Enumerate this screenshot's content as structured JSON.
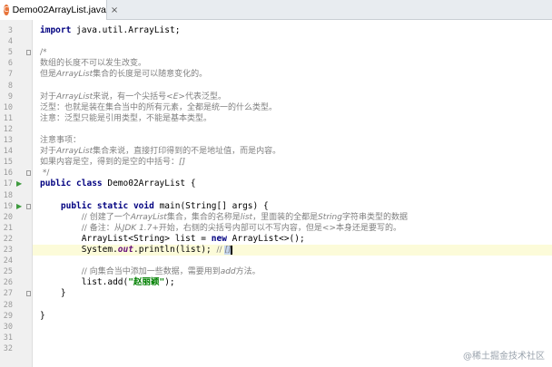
{
  "tab": {
    "icon": "java-class-icon",
    "title": "Demo02ArrayList.java",
    "close": "×"
  },
  "lines": [
    {
      "n": "3",
      "parts": [
        {
          "t": "import ",
          "c": "kw"
        },
        {
          "t": "java.util.ArrayList;",
          "c": ""
        }
      ]
    },
    {
      "n": "4",
      "parts": []
    },
    {
      "n": "5",
      "parts": [
        {
          "t": "/*",
          "c": "cm"
        }
      ]
    },
    {
      "n": "6",
      "parts": [
        {
          "t": "数组的长度不可以发生改变。",
          "c": "cm"
        }
      ]
    },
    {
      "n": "7",
      "parts": [
        {
          "t": "但是",
          "c": "cm"
        },
        {
          "t": "ArrayList",
          "c": "cm cmi"
        },
        {
          "t": "集合的长度是可以随意变化的。",
          "c": "cm"
        }
      ]
    },
    {
      "n": "8",
      "parts": []
    },
    {
      "n": "9",
      "parts": [
        {
          "t": "对于",
          "c": "cm"
        },
        {
          "t": "ArrayList",
          "c": "cm cmi"
        },
        {
          "t": "来说，有一个尖括号",
          "c": "cm"
        },
        {
          "t": "<E>",
          "c": "cm cmi"
        },
        {
          "t": "代表泛型。",
          "c": "cm"
        }
      ]
    },
    {
      "n": "10",
      "parts": [
        {
          "t": "泛型：也就是装在集合当中的所有元素，全都是统一的什么类型。",
          "c": "cm"
        }
      ]
    },
    {
      "n": "11",
      "parts": [
        {
          "t": "注意：泛型只能是引用类型，不能是基本类型。",
          "c": "cm"
        }
      ]
    },
    {
      "n": "12",
      "parts": []
    },
    {
      "n": "13",
      "parts": [
        {
          "t": "注意事项：",
          "c": "cm"
        }
      ]
    },
    {
      "n": "14",
      "parts": [
        {
          "t": "对于",
          "c": "cm"
        },
        {
          "t": "ArrayList",
          "c": "cm cmi"
        },
        {
          "t": "集合来说，直接打印得到的不是地址值，而是内容。",
          "c": "cm"
        }
      ]
    },
    {
      "n": "15",
      "parts": [
        {
          "t": "如果内容是空，得到的是空的中括号：",
          "c": "cm"
        },
        {
          "t": "[]",
          "c": "cm cmi"
        }
      ]
    },
    {
      "n": "16",
      "parts": [
        {
          "t": " */",
          "c": "cm"
        }
      ]
    },
    {
      "n": "17",
      "parts": [
        {
          "t": "public class ",
          "c": "kw"
        },
        {
          "t": "Demo02ArrayList {",
          "c": ""
        }
      ]
    },
    {
      "n": "18",
      "parts": []
    },
    {
      "n": "19",
      "parts": [
        {
          "t": "    ",
          "c": ""
        },
        {
          "t": "public static void ",
          "c": "kw"
        },
        {
          "t": "main(String[] args) {",
          "c": ""
        }
      ]
    },
    {
      "n": "20",
      "parts": [
        {
          "t": "        ",
          "c": ""
        },
        {
          "t": "// 创建了一个",
          "c": "cm"
        },
        {
          "t": "ArrayList",
          "c": "cm cmi"
        },
        {
          "t": "集合，集合的名称是",
          "c": "cm"
        },
        {
          "t": "list",
          "c": "cm cmi"
        },
        {
          "t": "，里面装的全都是",
          "c": "cm"
        },
        {
          "t": "String",
          "c": "cm cmi"
        },
        {
          "t": "字符串类型的数据",
          "c": "cm"
        }
      ]
    },
    {
      "n": "21",
      "parts": [
        {
          "t": "        ",
          "c": ""
        },
        {
          "t": "// 备注：从",
          "c": "cm"
        },
        {
          "t": "JDK 1.7+",
          "c": "cm cmi"
        },
        {
          "t": "开始，右侧的尖括号内部可以不写内容，但是<>本身还是要写的。",
          "c": "cm"
        }
      ]
    },
    {
      "n": "22",
      "parts": [
        {
          "t": "        ArrayList<String> list = ",
          "c": ""
        },
        {
          "t": "new ",
          "c": "kw"
        },
        {
          "t": "ArrayList<>();",
          "c": ""
        }
      ]
    },
    {
      "n": "23",
      "parts": [
        {
          "t": "        System.",
          "c": ""
        },
        {
          "t": "out",
          "c": "sf"
        },
        {
          "t": ".println(list); ",
          "c": ""
        },
        {
          "t": "// ",
          "c": "cm"
        },
        {
          "t": "[]",
          "c": "cm cmi hl"
        }
      ]
    },
    {
      "n": "24",
      "parts": []
    },
    {
      "n": "25",
      "parts": [
        {
          "t": "        ",
          "c": ""
        },
        {
          "t": "// 向集合当中添加一些数据，需要用到",
          "c": "cm"
        },
        {
          "t": "add",
          "c": "cm cmi"
        },
        {
          "t": "方法。",
          "c": "cm"
        }
      ]
    },
    {
      "n": "26",
      "parts": [
        {
          "t": "        list.add(",
          "c": ""
        },
        {
          "t": "\"赵丽颖\"",
          "c": "st"
        },
        {
          "t": ");",
          "c": ""
        }
      ]
    },
    {
      "n": "27",
      "parts": [
        {
          "t": "    }",
          "c": ""
        }
      ]
    },
    {
      "n": "28",
      "parts": []
    },
    {
      "n": "29",
      "parts": [
        {
          "t": "}",
          "c": ""
        }
      ]
    },
    {
      "n": "30",
      "parts": []
    },
    {
      "n": "31",
      "parts": []
    },
    {
      "n": "32",
      "parts": []
    }
  ],
  "current_line": "23",
  "run_markers": [
    "17",
    "19"
  ],
  "watermark": "@稀土掘金技术社区"
}
